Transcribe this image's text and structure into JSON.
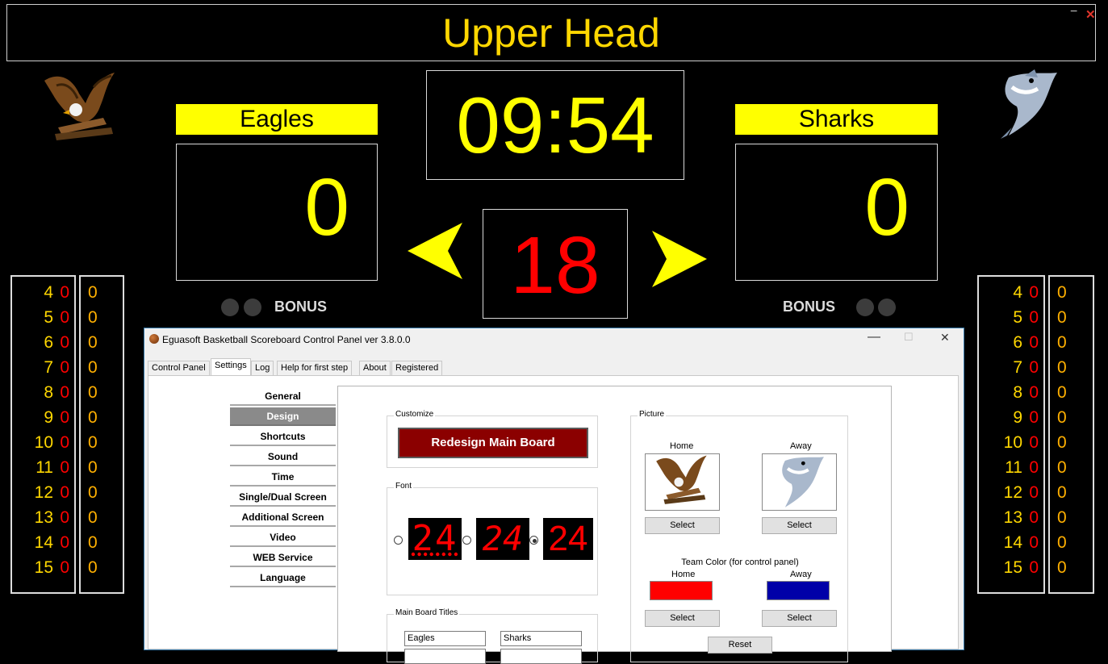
{
  "board": {
    "title": "Upper Head",
    "minimize": "−",
    "close": "✕",
    "home": {
      "name": "Eagles",
      "score": "0"
    },
    "away": {
      "name": "Sharks",
      "score": "0"
    },
    "clock": "09:54",
    "shot_clock": "18",
    "possession_left": "◀",
    "possession_right": "▶",
    "bonus_label": "BONUS",
    "home_players": [
      {
        "num": "4",
        "fouls": "0",
        "points": "0"
      },
      {
        "num": "5",
        "fouls": "0",
        "points": "0"
      },
      {
        "num": "6",
        "fouls": "0",
        "points": "0"
      },
      {
        "num": "7",
        "fouls": "0",
        "points": "0"
      },
      {
        "num": "8",
        "fouls": "0",
        "points": "0"
      },
      {
        "num": "9",
        "fouls": "0",
        "points": "0"
      },
      {
        "num": "10",
        "fouls": "0",
        "points": "0"
      },
      {
        "num": "11",
        "fouls": "0",
        "points": "0"
      },
      {
        "num": "12",
        "fouls": "0",
        "points": "0"
      },
      {
        "num": "13",
        "fouls": "0",
        "points": "0"
      },
      {
        "num": "14",
        "fouls": "0",
        "points": "0"
      },
      {
        "num": "15",
        "fouls": "0",
        "points": "0"
      }
    ],
    "away_players": [
      {
        "num": "4",
        "fouls": "0",
        "points": "0"
      },
      {
        "num": "5",
        "fouls": "0",
        "points": "0"
      },
      {
        "num": "6",
        "fouls": "0",
        "points": "0"
      },
      {
        "num": "7",
        "fouls": "0",
        "points": "0"
      },
      {
        "num": "8",
        "fouls": "0",
        "points": "0"
      },
      {
        "num": "9",
        "fouls": "0",
        "points": "0"
      },
      {
        "num": "10",
        "fouls": "0",
        "points": "0"
      },
      {
        "num": "11",
        "fouls": "0",
        "points": "0"
      },
      {
        "num": "12",
        "fouls": "0",
        "points": "0"
      },
      {
        "num": "13",
        "fouls": "0",
        "points": "0"
      },
      {
        "num": "14",
        "fouls": "0",
        "points": "0"
      },
      {
        "num": "15",
        "fouls": "0",
        "points": "0"
      }
    ],
    "home_logo_icon": "eagle-icon",
    "away_logo_icon": "shark-icon"
  },
  "control_panel": {
    "title": "Eguasoft Basketball Scoreboard Control Panel ver 3.8.0.0",
    "window_minimize": "—",
    "window_maximize": "☐",
    "window_close": "✕",
    "tabs": [
      "Control Panel",
      "Settings",
      "Log",
      "Help for first step",
      "About",
      "Registered"
    ],
    "selected_tab": "Settings",
    "nav": [
      "General",
      "Design",
      "Shortcuts",
      "Sound",
      "Time",
      "Single/Dual Screen",
      "Additional Screen",
      "Video",
      "WEB Service",
      "Language"
    ],
    "selected_nav": "Design",
    "customize": {
      "label": "Customize",
      "button": "Redesign Main Board"
    },
    "font": {
      "label": "Font",
      "preview_text": "24",
      "selected_index": 2
    },
    "picture": {
      "label": "Picture",
      "home_label": "Home",
      "away_label": "Away",
      "select_label": "Select",
      "team_color_label": "Team Color (for control panel)",
      "home_color": "#ff0000",
      "away_color": "#0000a8",
      "reset_label": "Reset"
    },
    "titles": {
      "label": "Main Board Titles",
      "home_title": "Eagles",
      "away_title": "Sharks"
    }
  },
  "colors": {
    "score_yellow": "#ffff00",
    "title_gold": "#ffd700",
    "shot_red": "#ff0000",
    "design_nav_selected": "#8a8a8a",
    "redesign_button": "#8b0000"
  }
}
